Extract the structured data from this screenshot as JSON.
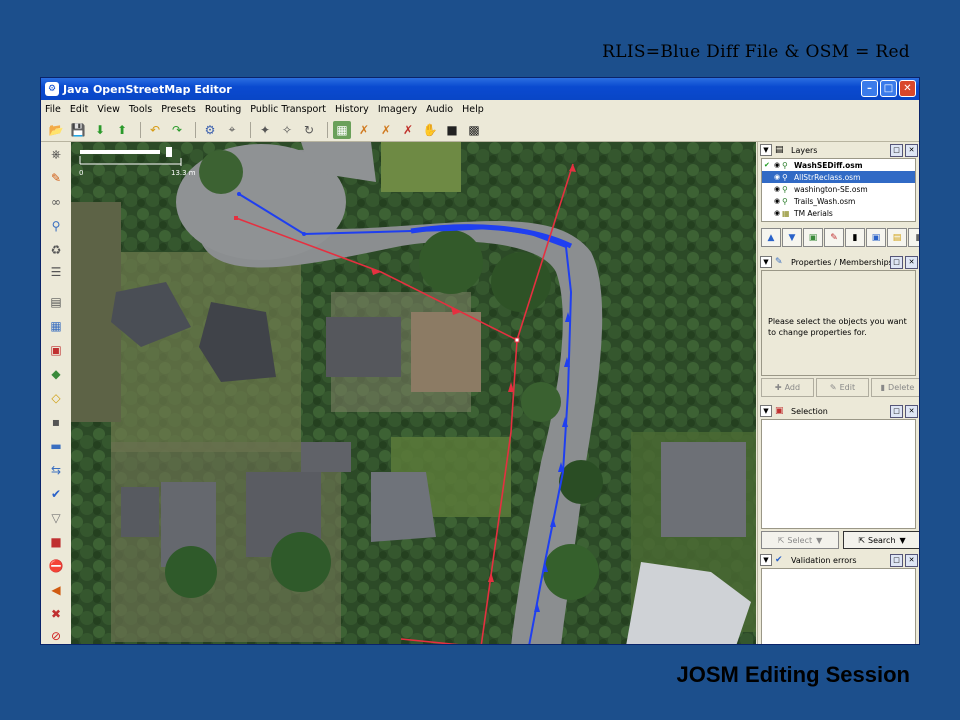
{
  "slide": {
    "subtitle": "RLIS=Blue  Diff File & OSM = Red",
    "title": "JOSM Editing Session"
  },
  "window": {
    "title": "Java OpenStreetMap Editor",
    "controls": [
      "minimize",
      "maximize",
      "close"
    ]
  },
  "menu": [
    "File",
    "Edit",
    "View",
    "Tools",
    "Presets",
    "Routing",
    "Public Transport",
    "History",
    "Imagery",
    "Audio",
    "Help"
  ],
  "map": {
    "scale_start": "0",
    "scale_end": "13.3 m",
    "colors": {
      "rlis_line": "#1f3ff0",
      "osm_line": "#e53040"
    }
  },
  "layers_panel": {
    "title": "Layers",
    "items": [
      {
        "name": "WashSEDiff.osm",
        "active": true,
        "selected": false
      },
      {
        "name": "AllStrReclass.osm",
        "active": false,
        "selected": true
      },
      {
        "name": "washington-SE.osm",
        "active": false,
        "selected": false
      },
      {
        "name": "Trails_Wash.osm",
        "active": false,
        "selected": false
      },
      {
        "name": "TM Aerials",
        "active": false,
        "selected": false
      }
    ]
  },
  "properties_panel": {
    "title": "Properties / Memberships",
    "message": "Please select the objects you want to change properties for.",
    "add_label": "Add",
    "edit_label": "Edit",
    "delete_label": "Delete"
  },
  "selection_panel": {
    "title": "Selection",
    "select_label": "Select",
    "search_label": "Search"
  },
  "validation_panel": {
    "title": "Validation errors"
  }
}
